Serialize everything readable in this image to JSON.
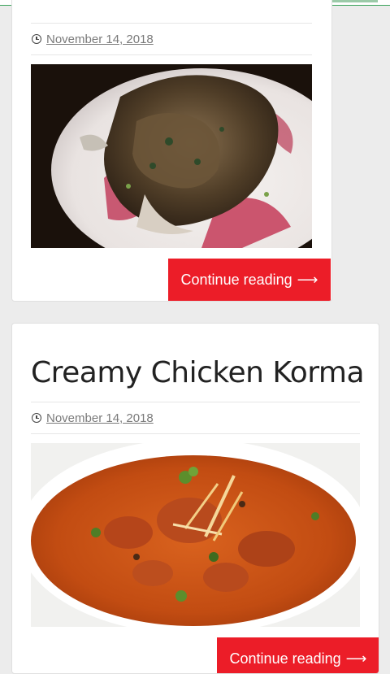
{
  "posts": [
    {
      "title": "",
      "date": "November 14, 2018",
      "image_alt": "grilled herb chicken on a plate",
      "cta_label": "Continue reading",
      "cta_arrow": "⟶"
    },
    {
      "title": "Creamy Chicken Korma",
      "date": "November 14, 2018",
      "image_alt": "chicken korma curry in a bowl",
      "cta_label": "Continue reading",
      "cta_arrow": "⟶"
    }
  ],
  "colors": {
    "accent": "#ec1d28",
    "background": "#ececec",
    "card": "#ffffff",
    "brand_green": "#3aa35b"
  },
  "icons": [
    "clock-icon",
    "arrow-right-icon"
  ]
}
